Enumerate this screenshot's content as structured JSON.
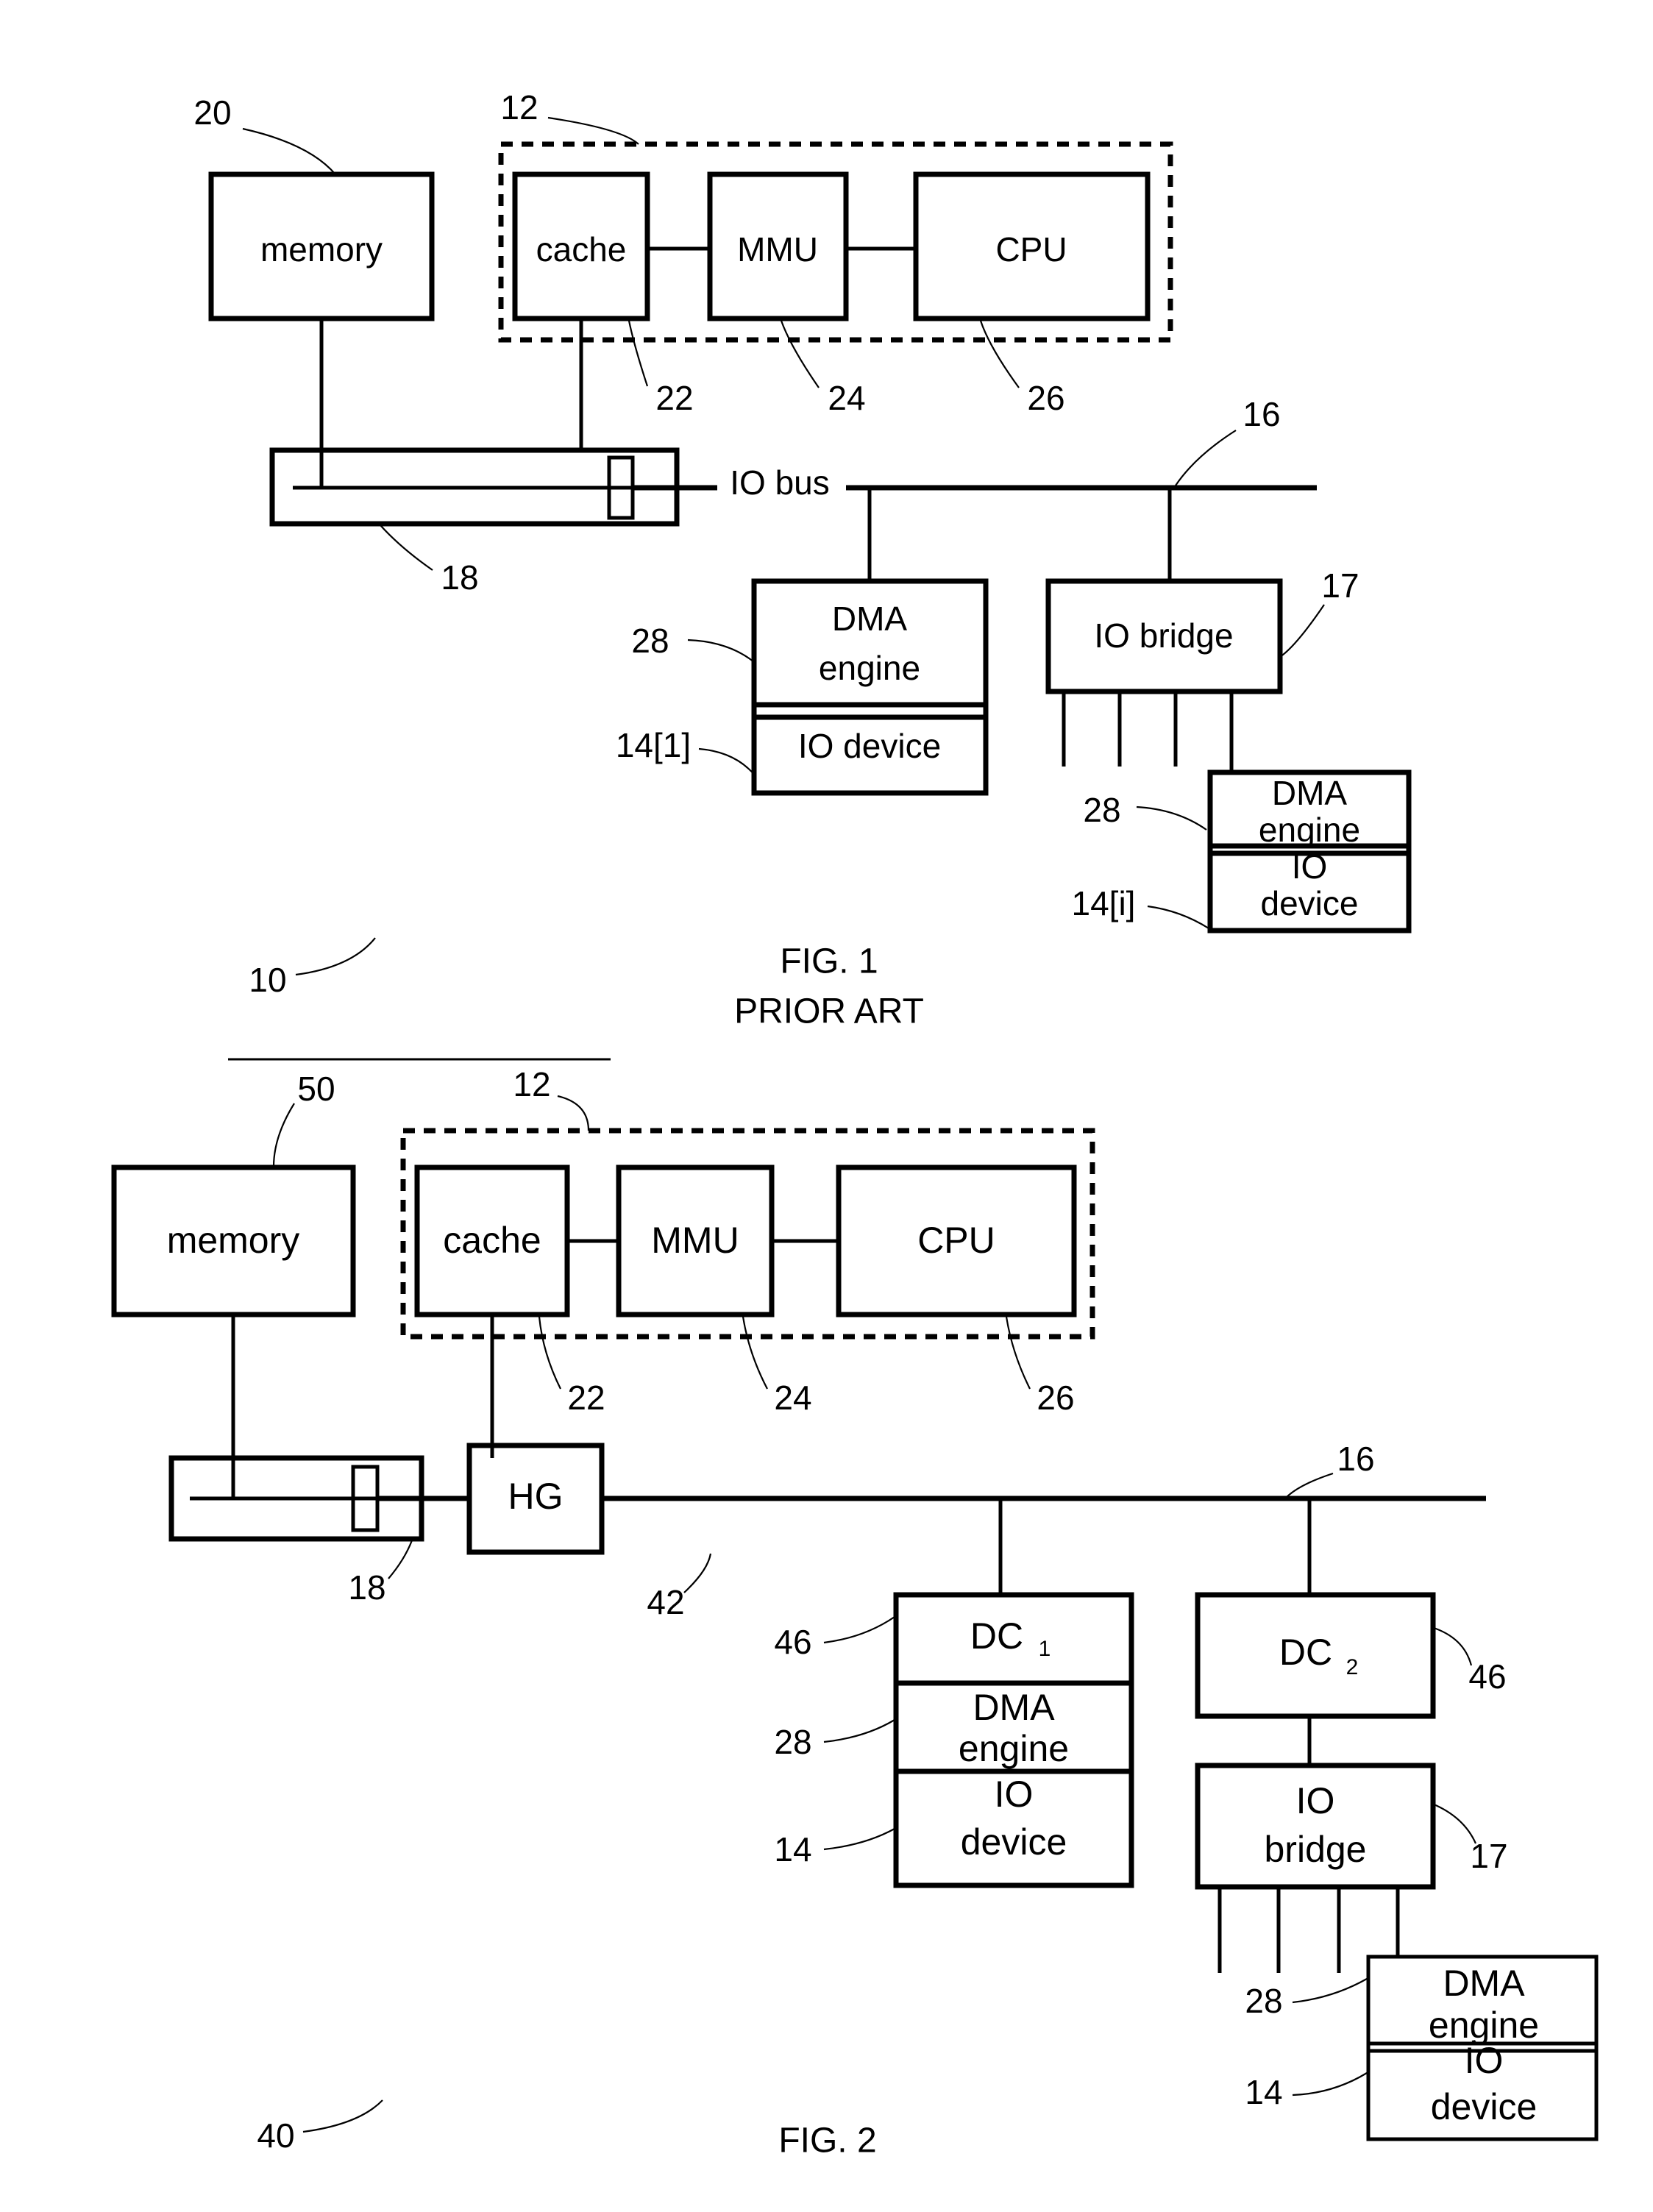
{
  "document": {
    "type": "patent-drawing-sheet",
    "figures": [
      {
        "id": "fig1",
        "caption_line1": "FIG. 1",
        "caption_line2": "PRIOR ART",
        "system_ref": "10",
        "bus_label": "IO bus",
        "blocks": {
          "memory": "memory",
          "cache": "cache",
          "mmu": "MMU",
          "cpu": "CPU",
          "dma_engine_1": "DMA\nengine",
          "dma_engine_1_line1": "DMA",
          "dma_engine_1_line2": "engine",
          "io_device_1": "IO device",
          "io_bridge": "IO bridge",
          "dma_engine_i_line1": "DMA",
          "dma_engine_i_line2": "engine",
          "io_device_i_line1": "IO",
          "io_device_i_line2": "device"
        },
        "refs": {
          "memory": "20",
          "processor_group": "12",
          "cache": "22",
          "mmu": "24",
          "cpu": "26",
          "memory_bus": "18",
          "io_bus": "16",
          "io_bridge": "17",
          "dma_engine_1": "28",
          "io_device_1": "14[1]",
          "dma_engine_i": "28",
          "io_device_i": "14[i]"
        }
      },
      {
        "id": "fig2",
        "caption_line1": "FIG. 2",
        "system_ref": "40",
        "blocks": {
          "memory": "memory",
          "cache": "cache",
          "mmu": "MMU",
          "cpu": "CPU",
          "hg": "HG",
          "dc1_base": "DC",
          "dc1_sub": "1",
          "dc2_base": "DC",
          "dc2_sub": "2",
          "dma_engine_line1": "DMA",
          "dma_engine_line2": "engine",
          "io_device_line1": "IO",
          "io_device_line2": "device",
          "io_bridge_line1": "IO",
          "io_bridge_line2": "bridge",
          "dma_engine_b_line1": "DMA",
          "dma_engine_b_line2": "engine",
          "io_device_b_line1": "IO",
          "io_device_b_line2": "device"
        },
        "refs": {
          "memory": "50",
          "processor_group": "12",
          "cache": "22",
          "mmu": "24",
          "cpu": "26",
          "memory_bus": "18",
          "hg": "42",
          "io_bus": "16",
          "dc1": "46",
          "dc2": "46",
          "dma_engine_dc1": "28",
          "io_device_dc1": "14",
          "io_bridge": "17",
          "dma_engine_bottom": "28",
          "io_device_bottom": "14"
        }
      }
    ]
  },
  "colors": {
    "ink": "#000000",
    "paper": "#ffffff"
  }
}
